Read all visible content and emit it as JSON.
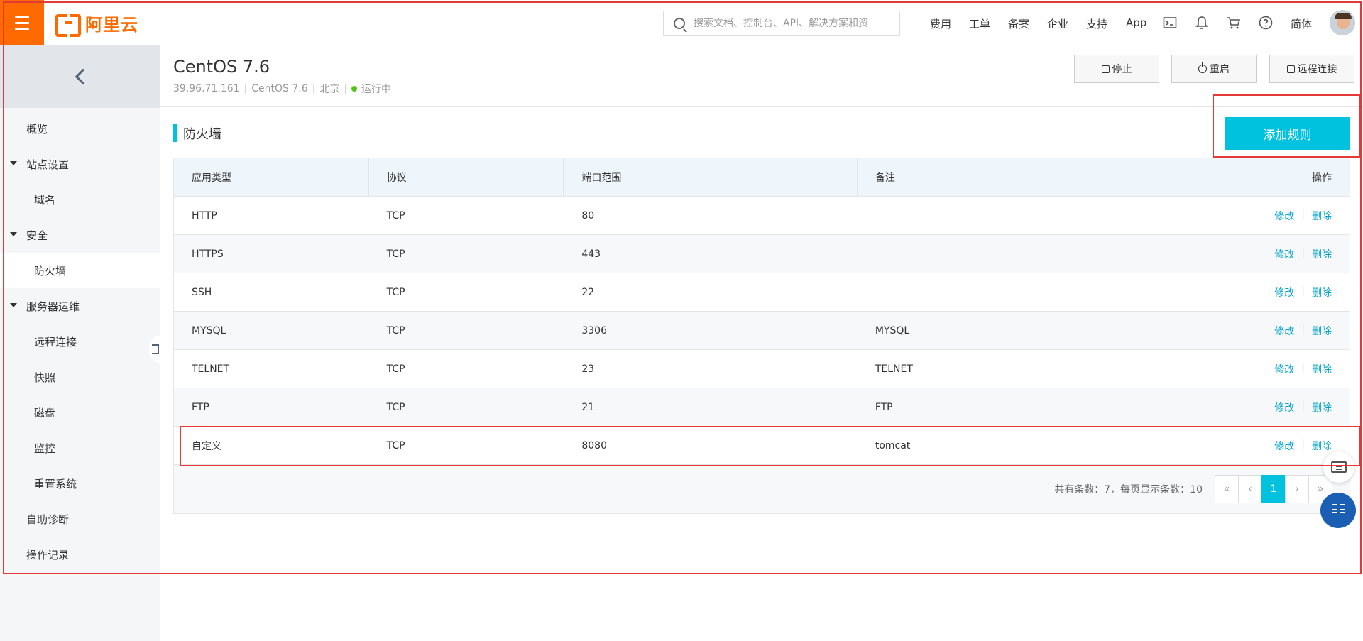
{
  "header": {
    "logo_text": "阿里云",
    "search_placeholder": "搜索文档、控制台、API、解决方案和资",
    "nav_links": [
      "费用",
      "工单",
      "备案",
      "企业",
      "支持",
      "App"
    ],
    "language": "简体"
  },
  "sidebar": {
    "items": [
      {
        "label": "概览"
      },
      {
        "label": "站点设置"
      },
      {
        "label": "域名"
      },
      {
        "label": "安全"
      },
      {
        "label": "防火墙"
      },
      {
        "label": "服务器运维"
      },
      {
        "label": "远程连接"
      },
      {
        "label": "快照"
      },
      {
        "label": "磁盘"
      },
      {
        "label": "监控"
      },
      {
        "label": "重置系统"
      },
      {
        "label": "自助诊断"
      },
      {
        "label": "操作记录"
      }
    ]
  },
  "instance": {
    "title": "CentOS 7.6",
    "ip": "39.96.71.161",
    "os": "CentOS 7.6",
    "region": "北京",
    "status": "运行中",
    "status_color": "#52c41a",
    "stop_label": "停止",
    "restart_label": "重启",
    "remote_label": "远程连接"
  },
  "firewall": {
    "title": "防火墙",
    "add_rule_label": "添加规则",
    "columns": [
      "应用类型",
      "协议",
      "端口范围",
      "备注",
      "操作"
    ],
    "rows": [
      {
        "app": "HTTP",
        "protocol": "TCP",
        "port": "80",
        "note": ""
      },
      {
        "app": "HTTPS",
        "protocol": "TCP",
        "port": "443",
        "note": ""
      },
      {
        "app": "SSH",
        "protocol": "TCP",
        "port": "22",
        "note": ""
      },
      {
        "app": "MYSQL",
        "protocol": "TCP",
        "port": "3306",
        "note": "MYSQL"
      },
      {
        "app": "TELNET",
        "protocol": "TCP",
        "port": "23",
        "note": "TELNET"
      },
      {
        "app": "FTP",
        "protocol": "TCP",
        "port": "21",
        "note": "FTP"
      },
      {
        "app": "自定义",
        "protocol": "TCP",
        "port": "8080",
        "note": "tomcat"
      }
    ],
    "edit_label": "修改",
    "delete_label": "删除",
    "pagination": {
      "summary": "共有条数：7，每页显示条数：10",
      "first": "«",
      "prev": "‹",
      "current": "1",
      "next": "›",
      "last": "»"
    }
  },
  "colors": {
    "brand": "#ff6a00",
    "accent": "#00c1de",
    "link": "#00a2ca",
    "annotation": "#e53935"
  }
}
